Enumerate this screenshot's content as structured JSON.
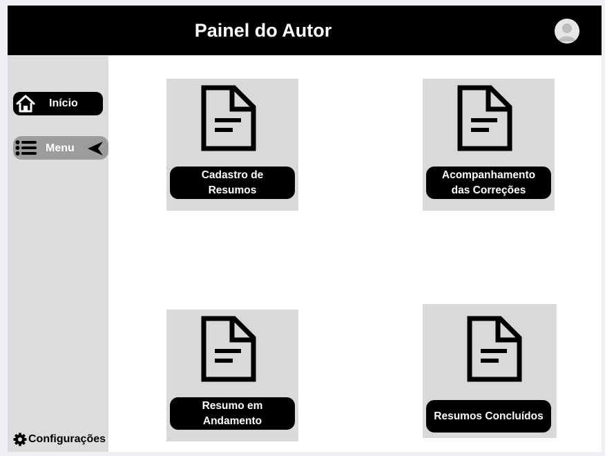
{
  "header": {
    "title": "Painel do Autor"
  },
  "sidebar": {
    "items": [
      {
        "label": "Início",
        "icon": "home-icon"
      },
      {
        "label": "Menu",
        "icon": "list-icon"
      }
    ],
    "settings_label": "Configurações"
  },
  "cards": [
    {
      "label": "Cadastro de Resumos",
      "icon": "document-icon"
    },
    {
      "label": "Acompanhamento das Correções",
      "icon": "document-icon"
    },
    {
      "label": "Resumo em Andamento",
      "icon": "document-icon"
    },
    {
      "label": "Resumos Concluídos",
      "icon": "document-icon"
    }
  ],
  "colors": {
    "header_bg": "#000000",
    "sidebar_bg": "#dcdcdc",
    "card_bg": "#d9d9d9",
    "active_menu_bg": "#9c9c9c"
  }
}
